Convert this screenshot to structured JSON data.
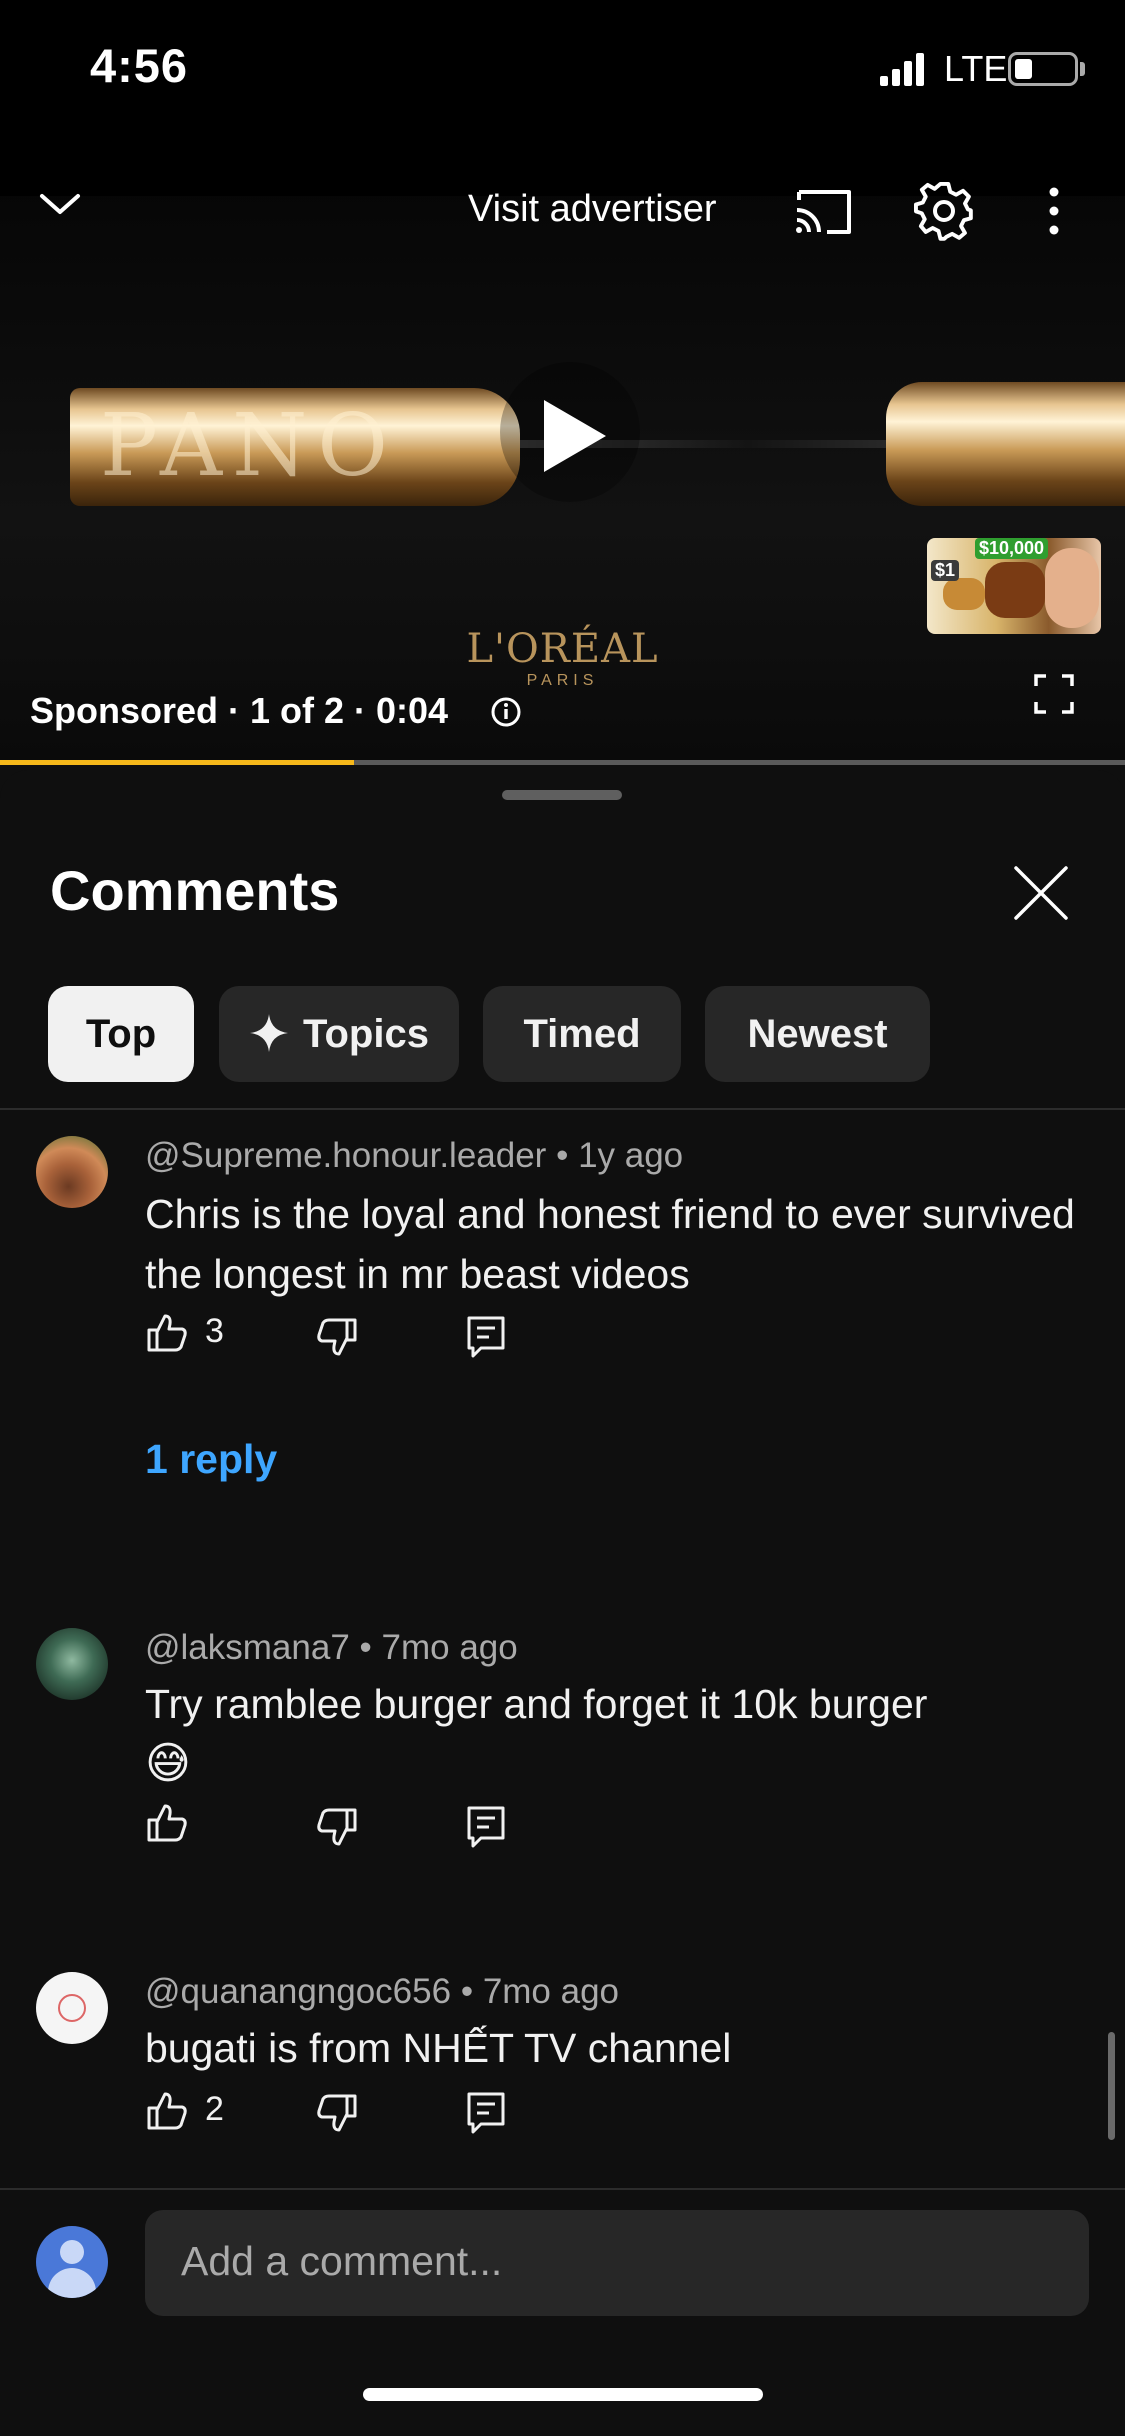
{
  "status_bar": {
    "time": "4:56",
    "network": "LTE",
    "battery_level": 0.3
  },
  "player": {
    "visit_advertiser_label": "Visit advertiser",
    "brand_logo": "L'ORÉAL",
    "brand_sub": "PARIS",
    "product_label": "PANO",
    "ad_meta": "Sponsored · 1 of 2 · 0:04",
    "progress": 0.315,
    "next_video_prices": [
      "$1",
      "$10,000"
    ],
    "accent_color": "#f6b81b",
    "icons": [
      "chevron-down-icon",
      "cast-icon",
      "gear-icon",
      "more-vertical-icon",
      "play-icon",
      "info-icon",
      "fullscreen-icon"
    ]
  },
  "comments_panel": {
    "title": "Comments",
    "chips": [
      {
        "label": "Top",
        "selected": true
      },
      {
        "label": "Topics",
        "selected": false
      },
      {
        "label": "Timed",
        "selected": false
      },
      {
        "label": "Newest",
        "selected": false
      }
    ],
    "comments": [
      {
        "author": "@Supreme.honour.leader",
        "age": "1y ago",
        "text": "Chris is the loyal and honest friend to ever survived the longest in mr beast videos",
        "likes": "3",
        "replies_label": "1 reply"
      },
      {
        "author": "@laksmana7",
        "age": "7mo ago",
        "text": "Try ramblee burger and forget it 10k burger",
        "emoji": "😅",
        "likes": ""
      },
      {
        "author": "@quanangngoc656",
        "age": "7mo ago",
        "text": "bugati is from NHẾT TV channel",
        "likes": "2"
      }
    ],
    "composer_placeholder": "Add a comment...",
    "link_color": "#3ea6ff"
  }
}
